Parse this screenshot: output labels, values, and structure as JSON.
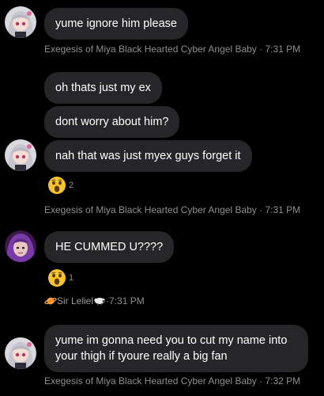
{
  "messages": [
    {
      "text": "yume ignore him please"
    },
    {
      "text": "oh thats just my ex"
    },
    {
      "text": "dont worry about him?"
    },
    {
      "text": "nah that was just myex guys forget it"
    },
    {
      "text": "HE CUMMED U????"
    },
    {
      "text": "yume im gonna need you to cut my name into your thigh if tyoure really a big fan"
    }
  ],
  "metas": [
    {
      "sender": "Exegesis of Miya Black Hearted Cyber Angel Baby",
      "separator": " · ",
      "time": "7:31 PM"
    },
    {
      "sender": "Exegesis of Miya Black Hearted Cyber Angel Baby",
      "separator": " · ",
      "time": "7:31 PM"
    },
    {
      "sender": "Sir Leliel",
      "separator": " · ",
      "time": "7:31 PM"
    },
    {
      "sender": "Exegesis of Miya Black Hearted Cyber Angel Baby",
      "separator": " · ",
      "time": "7:32 PM"
    }
  ],
  "reactions": [
    {
      "emoji": "shocked-face",
      "count": "2"
    },
    {
      "emoji": "shocked-face",
      "count": "1"
    }
  ],
  "colors": {
    "background": "#000000",
    "bubble": "#262628",
    "text": "#ffffff",
    "meta": "#8e8e93"
  }
}
